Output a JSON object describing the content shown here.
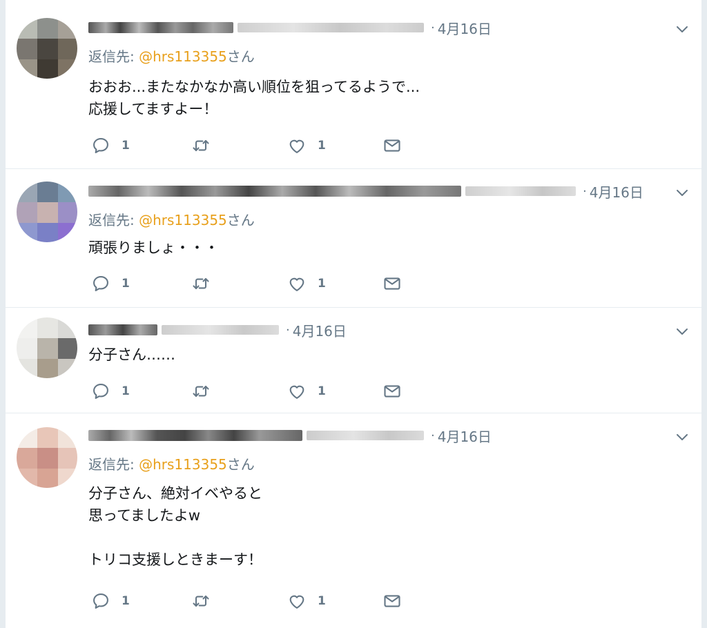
{
  "theme": {
    "accent": "#e8a01c",
    "muted": "#657786",
    "divider": "#e6ecf0"
  },
  "icons": {
    "reply": "speech-bubble-icon",
    "retweet": "retweet-arrows-icon",
    "like": "heart-icon",
    "dm": "envelope-icon",
    "menu": "chevron-down-icon"
  },
  "tweets": [
    {
      "separator": "·",
      "date": "4月16日",
      "reply_prefix": "返信先: ",
      "mention": "@hrs113355",
      "reply_suffix": "さん",
      "text": "おおお...またなかなか高い順位を狙ってるようで...\n応援してますよー！",
      "reply_count": "1",
      "like_count": "1"
    },
    {
      "separator": "·",
      "date": "4月16日",
      "reply_prefix": "返信先: ",
      "mention": "@hrs113355",
      "reply_suffix": "さん",
      "text": "頑張りましょ・・・",
      "reply_count": "1",
      "like_count": "1"
    },
    {
      "separator": "·",
      "date": "4月16日",
      "text": "分子さん……",
      "reply_count": "1",
      "like_count": "1"
    },
    {
      "separator": "·",
      "date": "4月16日",
      "reply_prefix": "返信先: ",
      "mention": "@hrs113355",
      "reply_suffix": "さん",
      "text": "分子さん、絶対イベやると\n思ってましたよw\n\nトリコ支援しときまーす！",
      "reply_count": "1",
      "like_count": "1"
    }
  ]
}
